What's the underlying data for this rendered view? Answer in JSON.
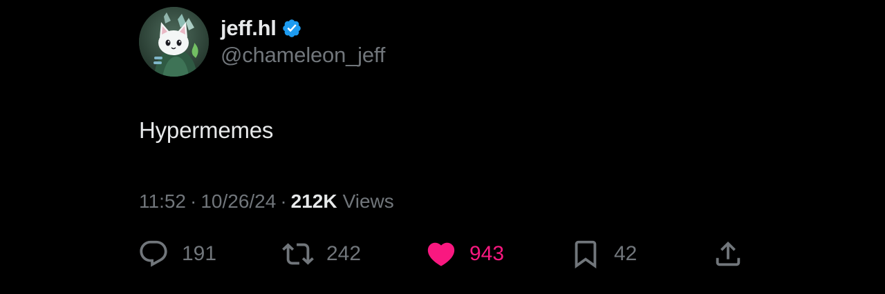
{
  "author": {
    "display_name": "jeff.hl",
    "handle": "@chameleon_jeff",
    "verified": true,
    "verified_color": "#1d9bf0"
  },
  "tweet": {
    "text": "Hypermemes"
  },
  "meta": {
    "time": "11:52",
    "separator": "·",
    "date": "10/26/24",
    "views_count": "212K",
    "views_label": "Views"
  },
  "actions": {
    "reply": {
      "icon": "reply-icon",
      "count": "191"
    },
    "retweet": {
      "icon": "retweet-icon",
      "count": "242"
    },
    "like": {
      "icon": "heart-icon",
      "count": "943",
      "active": true,
      "color": "#f91880"
    },
    "bookmark": {
      "icon": "bookmark-icon",
      "count": "42"
    },
    "share": {
      "icon": "share-icon"
    }
  },
  "colors": {
    "background": "#000000",
    "primary_text": "#e7e9ea",
    "secondary_text": "#71767b",
    "like_active": "#f91880",
    "verified": "#1d9bf0"
  }
}
